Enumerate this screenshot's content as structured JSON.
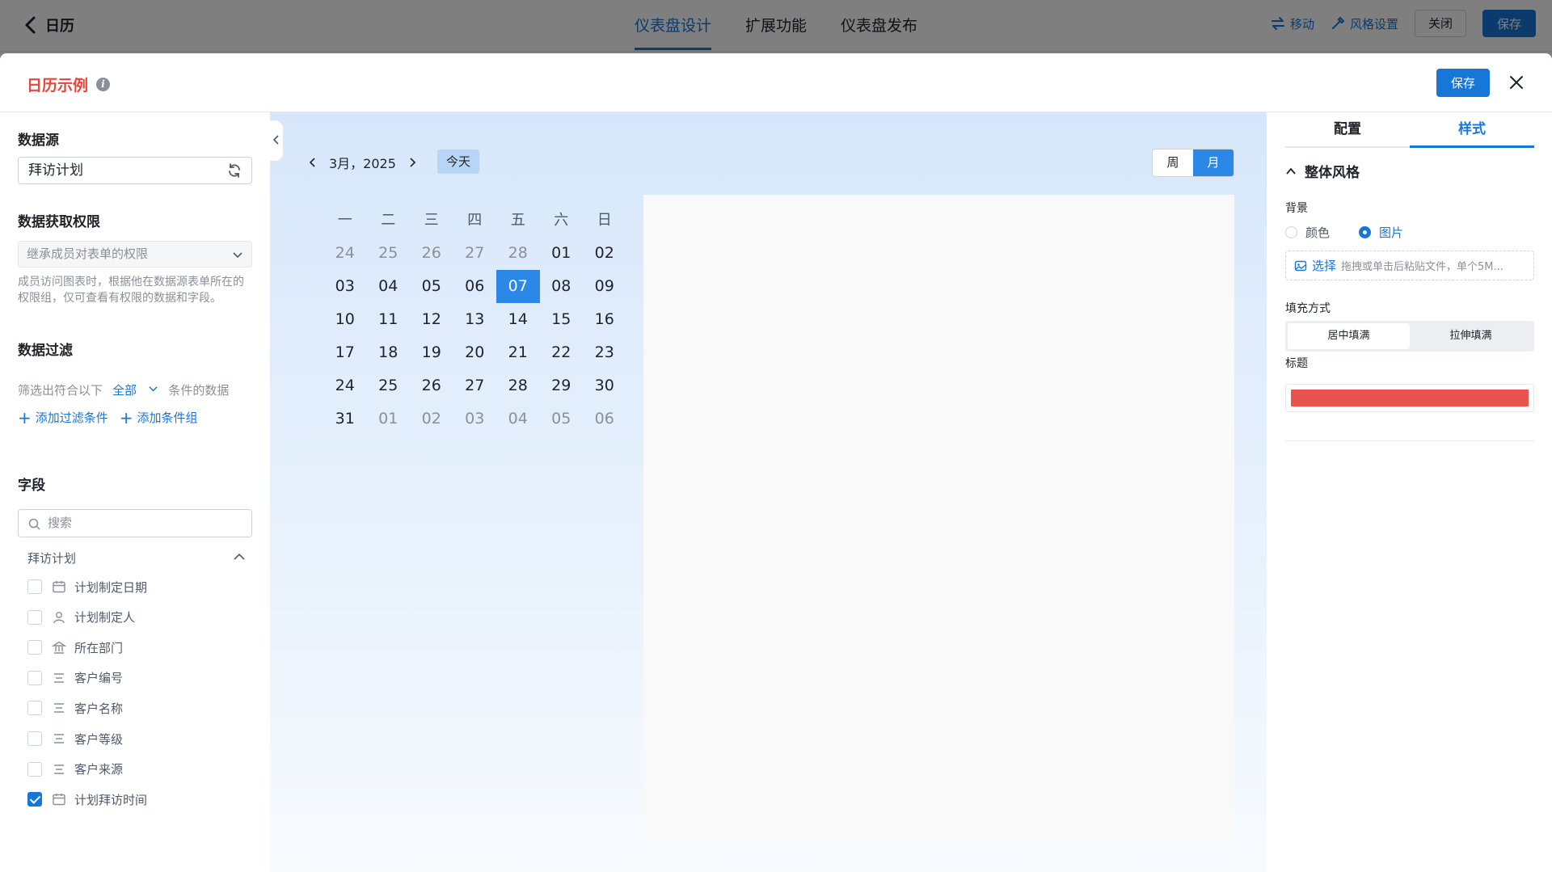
{
  "topbar": {
    "back_label": "日历",
    "tabs": [
      "仪表盘设计",
      "扩展功能",
      "仪表盘发布"
    ],
    "move_label": "移动",
    "style_label": "风格设置",
    "close_label": "关闭",
    "save_label": "保存"
  },
  "modal": {
    "title": "日历示例",
    "info_glyph": "i",
    "save_label": "保存"
  },
  "left": {
    "datasource_title": "数据源",
    "datasource_value": "拜访计划",
    "permission_title": "数据获取权限",
    "permission_value": "继承成员对表单的权限",
    "permission_hint": "成员访问图表时，根据他在数据源表单所在的权限组，仅可查看有权限的数据和字段。",
    "filter_title": "数据过滤",
    "filter_prefix": "筛选出符合以下",
    "filter_mode": "全部",
    "filter_suffix": "条件的数据",
    "add_filter": "添加过滤条件",
    "add_group": "添加条件组",
    "fields_title": "字段",
    "search_placeholder": "搜索",
    "group_name": "拜访计划",
    "fields": [
      {
        "label": "计划制定日期",
        "icon": "calendar-icon",
        "checked": false
      },
      {
        "label": "计划制定人",
        "icon": "user-icon",
        "checked": false
      },
      {
        "label": "所在部门",
        "icon": "building-icon",
        "checked": false
      },
      {
        "label": "客户编号",
        "icon": "text-lines-icon",
        "checked": false
      },
      {
        "label": "客户名称",
        "icon": "text-lines-icon",
        "checked": false
      },
      {
        "label": "客户等级",
        "icon": "text-lines-icon",
        "checked": false
      },
      {
        "label": "客户来源",
        "icon": "text-lines-icon",
        "checked": false
      },
      {
        "label": "计划拜访时间",
        "icon": "calendar-icon",
        "checked": true
      }
    ]
  },
  "calendar": {
    "month_label": "3月，2025",
    "today_label": "今天",
    "view_week": "周",
    "view_month": "月",
    "weekdays": [
      "一",
      "二",
      "三",
      "四",
      "五",
      "六",
      "日"
    ],
    "weeks": [
      [
        "24",
        "25",
        "26",
        "27",
        "28",
        "01",
        "02"
      ],
      [
        "03",
        "04",
        "05",
        "06",
        "07",
        "08",
        "09"
      ],
      [
        "10",
        "11",
        "12",
        "13",
        "14",
        "15",
        "16"
      ],
      [
        "17",
        "18",
        "19",
        "20",
        "21",
        "22",
        "23"
      ],
      [
        "24",
        "25",
        "26",
        "27",
        "28",
        "29",
        "30"
      ],
      [
        "31",
        "01",
        "02",
        "03",
        "04",
        "05",
        "06"
      ]
    ],
    "selected_day": "07"
  },
  "right": {
    "tab_config": "配置",
    "tab_style": "样式",
    "section_title": "整体风格",
    "bg_label": "背景",
    "bg_color": "颜色",
    "bg_image": "图片",
    "upload_select": "选择",
    "upload_hint": "拖拽或单击后粘贴文件，单个5M...",
    "fill_label": "填充方式",
    "fill_center": "居中填满",
    "fill_stretch": "拉伸填满",
    "title_label": "标题",
    "title_color": "#e8524f"
  }
}
